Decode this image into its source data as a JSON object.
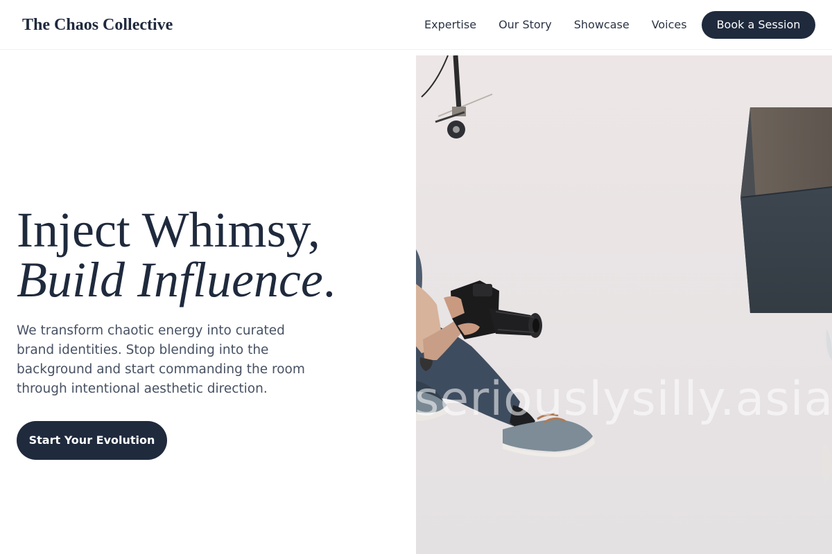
{
  "header": {
    "brand": "The Chaos Collective",
    "nav": [
      "Expertise",
      "Our Story",
      "Showcase",
      "Voices"
    ],
    "cta_label": "Book a Session"
  },
  "hero": {
    "title_line1": "Inject Whimsy,",
    "title_line2_italic": "Build Influence",
    "title_line2_period": ".",
    "subtitle": "We transform chaotic energy into curated brand identities. Stop blending into the background and start commanding the room through intentional aesthetic direction.",
    "cta_label": "Start Your Evolution",
    "image_watermark": "seriouslysilly.asia"
  },
  "colors": {
    "primary": "#1f2a3d",
    "body_text": "#475163",
    "background": "#ffffff",
    "photo_backdrop": "#ebe6e6"
  }
}
